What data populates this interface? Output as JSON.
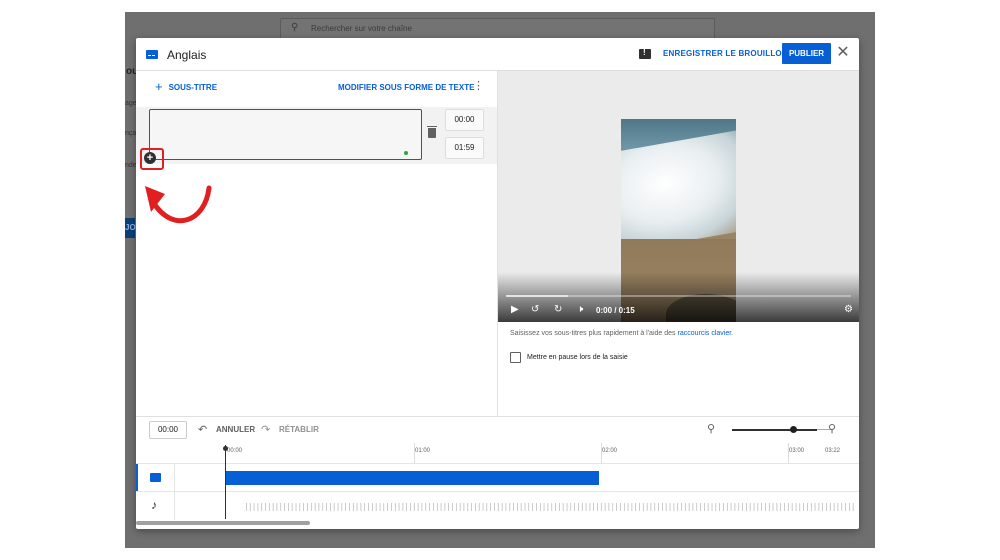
{
  "background": {
    "search_placeholder": "Rechercher sur votre chaîne",
    "fragments": [
      "ou",
      "age",
      "nça",
      "nde",
      "JO"
    ]
  },
  "header": {
    "language": "Anglais",
    "save_draft_label": "ENREGISTRER LE BROUILLON",
    "publish_label": "PUBLIER",
    "icons": [
      "subtitles-icon",
      "feedback-icon",
      "close-icon"
    ]
  },
  "editor": {
    "add_subtitle_label": "SOUS-TITRE",
    "edit_as_text_label": "MODIFIER SOUS FORME DE TEXTE",
    "cue": {
      "text": "",
      "start": "00:00",
      "end": "01:59"
    }
  },
  "player": {
    "time_display": "0:00 / 0:15",
    "progress": 0.18,
    "hint_text": "Saisissez vos sous-titres plus rapidement à l'aide des ",
    "hint_link": "raccourcis clavier",
    "hint_end": ".",
    "pause_checkbox_label": "Mettre en pause lors de la saisie",
    "pause_checked": false
  },
  "timeline": {
    "current_time": "00:00",
    "undo_label": "ANNULER",
    "redo_label": "RÉTABLIR",
    "zoom_level": 0.7,
    "ruler_labels": [
      "00:00",
      "01:00",
      "02:00",
      "03:00",
      "03:22"
    ],
    "subtitle_block": {
      "start": "00:00",
      "end": "01:59"
    }
  },
  "colors": {
    "accent": "#065fd4",
    "highlight": "#e02020"
  }
}
